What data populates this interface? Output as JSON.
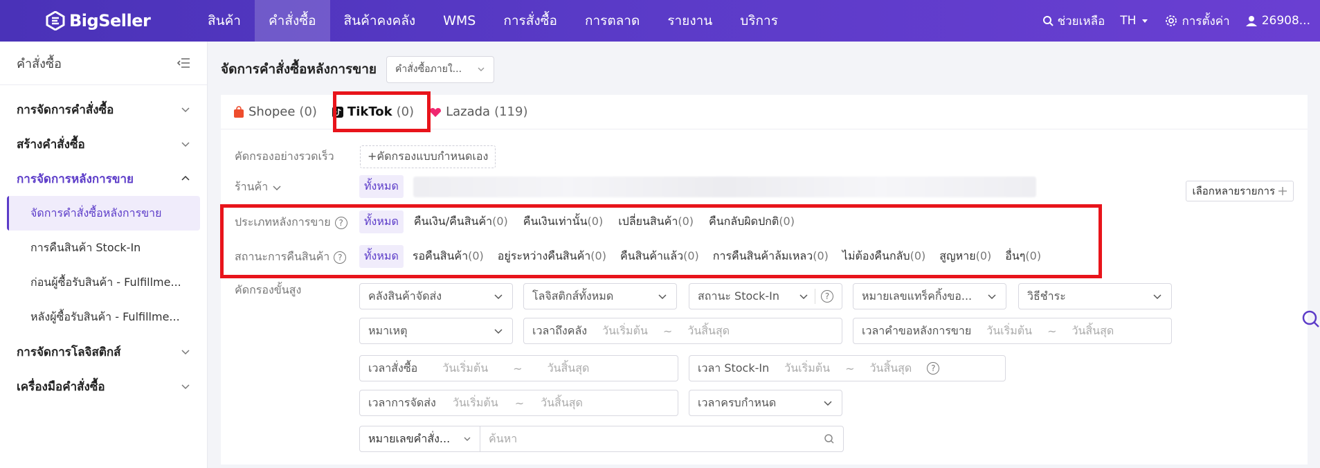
{
  "app": {
    "logo_text": "BigSeller"
  },
  "nav": {
    "items": [
      "สินค้า",
      "คำสั่งซื้อ",
      "สินค้าคงคลัง",
      "WMS",
      "การสั่งซื้อ",
      "การตลาด",
      "รายงาน",
      "บริการ"
    ],
    "active": "คำสั่งซื้อ"
  },
  "topright": {
    "help": "ช่วยเหลือ",
    "lang": "TH",
    "settings": "การตั้งค่า",
    "user": "26908..."
  },
  "sidebar": {
    "title": "คำสั่งซื้อ",
    "groups": [
      {
        "label": "การจัดการคำสั่งซื้อ"
      },
      {
        "label": "สร้างคำสั่งซื้อ"
      },
      {
        "label": "การจัดการหลังการขาย"
      },
      {
        "label": "การจัดการโลจิสติกส์"
      },
      {
        "label": "เครื่องมือคำสั่งซื้อ"
      }
    ],
    "sub_items": [
      "จัดการคำสั่งซื้อหลังการขาย",
      "การคืนสินค้า Stock-In",
      "ก่อนผู้ซื้อรับสินค้า - Fulfillme...",
      "หลังผู้ซื้อรับสินค้า - Fulfillme..."
    ]
  },
  "page": {
    "title": "จัดการคำสั่งซื้อหลังการขาย",
    "select_value": "คำสั่งซื้อภายใ..."
  },
  "tabs": [
    {
      "name": "Shopee",
      "count": "(0)"
    },
    {
      "name": "TikTok",
      "count": "(0)"
    },
    {
      "name": "Lazada",
      "count": "(119)"
    }
  ],
  "filters": {
    "quick_label": "คัดกรองอย่างรวดเร็ว",
    "custom_btn": "+คัดกรองแบบกำหนดเอง",
    "shop_label": "ร้านค้า",
    "shop_all": "ทั้งหมด",
    "multi_select": "เลือกหลายรายการ",
    "type_label": "ประเภทหลังการขาย",
    "type_chips": [
      {
        "label": "ทั้งหมด",
        "n": ""
      },
      {
        "label": "คืนเงิน/คืนสินค้า",
        "n": "(0)"
      },
      {
        "label": "คืนเงินเท่านั้น",
        "n": "(0)"
      },
      {
        "label": "เปลี่ยนสินค้า",
        "n": "(0)"
      },
      {
        "label": "คืนกลับผิดปกติ",
        "n": "(0)"
      }
    ],
    "status_label": "สถานะการคืนสินค้า",
    "status_chips": [
      {
        "label": "ทั้งหมด",
        "n": ""
      },
      {
        "label": "รอคืนสินค้า",
        "n": "(0)"
      },
      {
        "label": "อยู่ระหว่างคืนสินค้า",
        "n": "(0)"
      },
      {
        "label": "คืนสินค้าแล้ว",
        "n": "(0)"
      },
      {
        "label": "การคืนสินค้าล้มเหลว",
        "n": "(0)"
      },
      {
        "label": "ไม่ต้องคืนกลับ",
        "n": "(0)"
      },
      {
        "label": "สูญหาย",
        "n": "(0)"
      },
      {
        "label": "อื่นๆ",
        "n": "(0)"
      }
    ],
    "advanced_label": "คัดกรองขั้นสูง",
    "adv": {
      "warehouse": "คลังสินค้าจัดส่ง",
      "logistics": "โลจิสติกส์ทั้งหมด",
      "stockin_status": "สถานะ Stock-In",
      "tracking": "หมายเลขแทร็คกิ้งขอ...",
      "payment": "วิธีชำระ",
      "reason": "หมาเหตุ",
      "arrive_time": "เวลาถึงคลัง",
      "request_time": "เวลาคำขอหลังการขาย",
      "order_time": "เวลาสั่งซื้อ",
      "stockin_time": "เวลา Stock-In",
      "ship_time": "เวลาการจัดส่ง",
      "due_time": "เวลาครบกำหนด",
      "start": "วันเริ่มต้น",
      "end": "วันสิ้นสุด",
      "tilde": "~",
      "order_no": "หมายเลขคำสั่ง...",
      "search_ph": "ค้นหา"
    }
  },
  "colors": {
    "brand": "#5b3bc8",
    "highlight": "#e8141b"
  }
}
